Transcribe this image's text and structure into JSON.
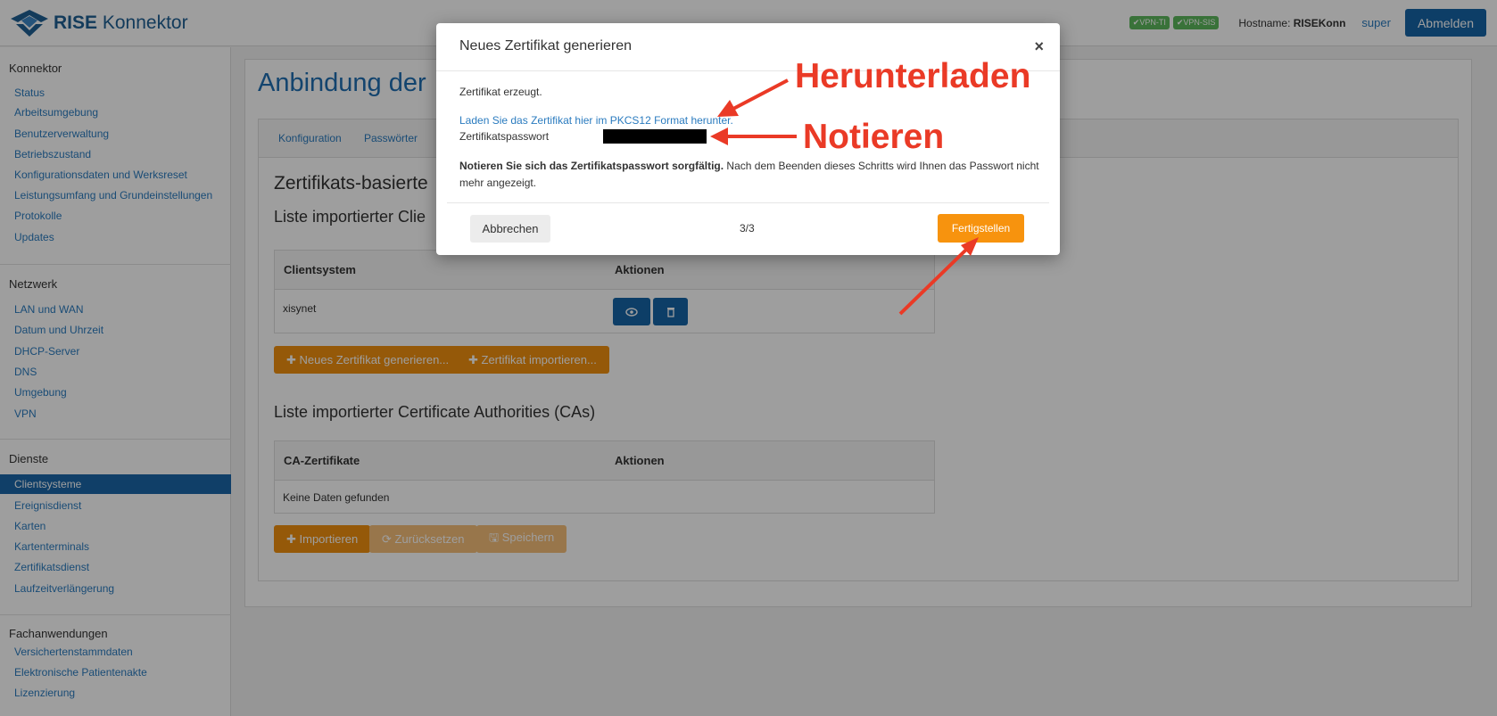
{
  "header": {
    "logo_bold": "RISE",
    "logo_rest": " Konnektor",
    "vpn_badges": [
      "✔VPN-TI",
      "✔VPN-SIS"
    ],
    "hostname_label": "Hostname: ",
    "hostname_value": "RISEKonn",
    "user": "super",
    "logout_label": "Abmelden"
  },
  "sidebar": {
    "groups": [
      {
        "title": "Konnektor",
        "items": [
          "Status",
          "Arbeitsumgebung",
          "Benutzerverwaltung",
          "Betriebszustand",
          "Konfigurationsdaten und Werksreset",
          "Leistungsumfang und Grundeinstellungen",
          "Protokolle",
          "Updates"
        ]
      },
      {
        "title": "Netzwerk",
        "items": [
          "LAN und WAN",
          "Datum und Uhrzeit",
          "DHCP-Server",
          "DNS",
          "Umgebung",
          "VPN"
        ]
      },
      {
        "title": "Dienste",
        "items": [
          "Clientsysteme",
          "Ereignisdienst",
          "Karten",
          "Kartenterminals",
          "Zertifikatsdienst",
          "Laufzeitverlängerung"
        ]
      },
      {
        "title": "Fachanwendungen",
        "items": [
          "Versichertenstammdaten",
          "Elektronische Patientenakte",
          "Lizenzierung"
        ]
      }
    ],
    "active_item": "Clientsysteme"
  },
  "main": {
    "page_title": "Anbindung der",
    "tabs": [
      "Konfiguration",
      "Passwörter"
    ],
    "section_title": "Zertifikats-basierte",
    "clients_title": "Liste importierter Clie",
    "clients_table": {
      "headers": [
        "Clientsystem",
        "Aktionen"
      ],
      "rows": [
        [
          "xisynet"
        ]
      ]
    },
    "btn_new_cert": "✚ Neues Zertifikat generieren...",
    "btn_import_cert": "✚ Zertifikat importieren...",
    "ca_title": "Liste importierter Certificate Authorities (CAs)",
    "ca_table": {
      "headers": [
        "CA-Zertifikate",
        "Aktionen"
      ],
      "empty": "Keine Daten gefunden"
    },
    "btn_import": "✚ Importieren",
    "btn_reset": "⟳ Zurücksetzen",
    "btn_save": "🖫 Speichern"
  },
  "modal": {
    "title": "Neues Zertifikat generieren",
    "close": "×",
    "created": "Zertifikat erzeugt.",
    "download_link": "Laden Sie das Zertifikat hier im PKCS12 Format herunter.",
    "password_label": "Zertifikatspasswort",
    "note_bold": "Notieren Sie sich das Zertifikatspasswort sorgfältig.",
    "note_rest": " Nach dem Beenden dieses Schritts wird Ihnen das Passwort nicht mehr angezeigt.",
    "cancel": "Abbrechen",
    "step": "3/3",
    "finish": "Fertigstellen"
  },
  "annotations": {
    "download": "Herunterladen",
    "note": "Notieren",
    "color": "#ea3a26"
  }
}
